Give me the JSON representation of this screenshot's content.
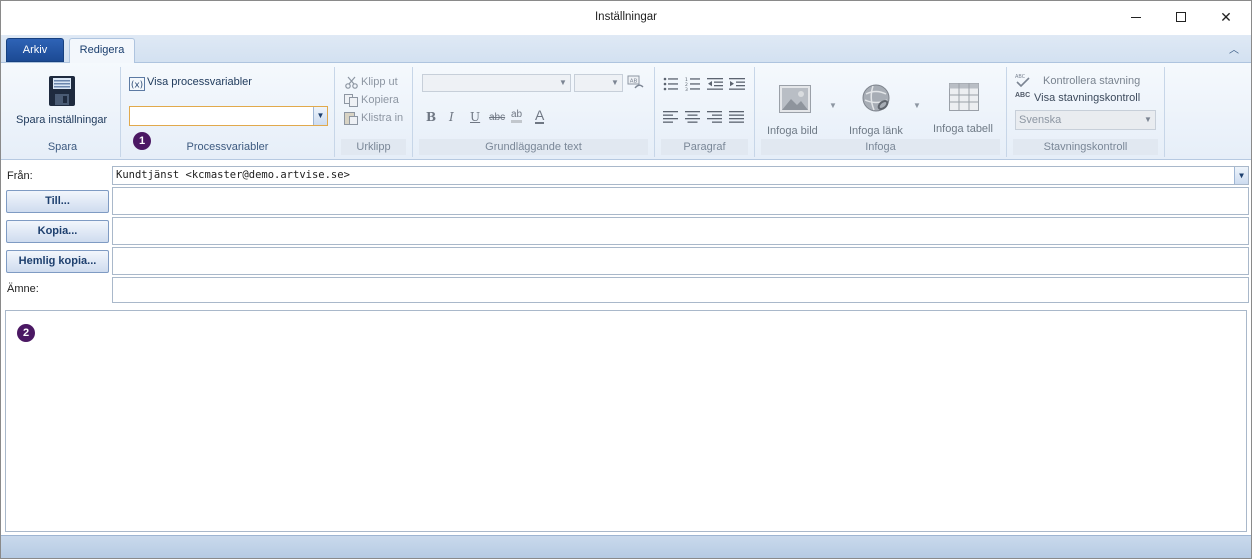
{
  "window": {
    "title": "Inställningar",
    "minimize_icon": "minimize-icon",
    "maximize_icon": "maximize-icon",
    "close_icon": "close-icon"
  },
  "ribbon": {
    "tabs": [
      {
        "label": "Arkiv",
        "active": false
      },
      {
        "label": "Redigera",
        "active": true
      }
    ],
    "groups": {
      "spara": {
        "label": "Spara",
        "save_button": "Spara inställningar",
        "save_icon": "floppy-disk-icon"
      },
      "processvariabler": {
        "label": "Processvariabler",
        "show_variables": "Visa processvariabler",
        "variable_value": "",
        "badge": "1"
      },
      "urklipp": {
        "label": "Urklipp",
        "cut": "Klipp ut",
        "copy": "Kopiera",
        "paste": "Klistra in"
      },
      "grundlaggande_text": {
        "label": "Grundläggande text",
        "font_name": "",
        "font_size": "",
        "bold": "B",
        "italic": "I",
        "underline": "U",
        "strikethrough": "abc",
        "highlight": "ab",
        "font_color": "A"
      },
      "paragraf": {
        "label": "Paragraf"
      },
      "infoga": {
        "label": "Infoga",
        "insert_image": "Infoga bild",
        "insert_link": "Infoga länk",
        "insert_table": "Infoga tabell"
      },
      "stavningskontroll": {
        "label": "Stavningskontroll",
        "check_spelling": "Kontrollera stavning",
        "show_spelling": "Visa stavningskontroll",
        "language": "Svenska",
        "abc_mark": "ABC"
      }
    }
  },
  "header": {
    "from_label": "Från:",
    "from_value": "Kundtjänst <kcmaster@demo.artvise.se>",
    "to_button": "Till...",
    "cc_button": "Kopia...",
    "bcc_button": "Hemlig kopia...",
    "subject_label": "Ämne:",
    "to_value": "",
    "cc_value": "",
    "bcc_value": "",
    "subject_value": ""
  },
  "body": {
    "badge": "2",
    "content": ""
  },
  "colors": {
    "accent": "#1c4a94",
    "ribbon_bg": "#e6eef8",
    "badge": "#4b1863",
    "focus_border": "#e1a94c"
  }
}
